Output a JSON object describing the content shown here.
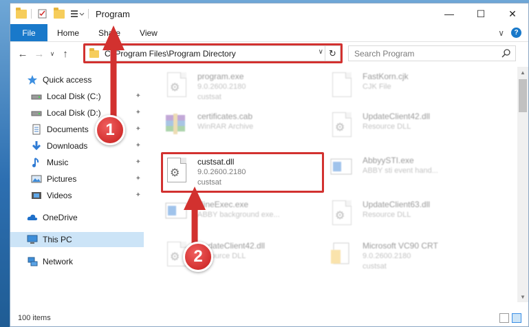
{
  "window": {
    "title": "Program",
    "controls": {
      "minimize": "—",
      "maximize": "☐",
      "close": "✕"
    }
  },
  "ribbon": {
    "file_label": "File",
    "tabs": [
      "Home",
      "Share",
      "View"
    ],
    "expand": "∨",
    "help": "?"
  },
  "nav": {
    "back": "←",
    "forward": "→",
    "recent": "∨",
    "up": "↑",
    "address": "C:\\Program Files\\Program Directory",
    "address_dropdown": "∨",
    "refresh": "↻",
    "search_placeholder": "Search Program"
  },
  "sidebar": {
    "items": [
      {
        "label": "Quick access",
        "icon": "star-icon",
        "pinned": false
      },
      {
        "label": "Local Disk (C:)",
        "icon": "drive-icon",
        "pinned": true
      },
      {
        "label": "Local Disk (D:)",
        "icon": "drive-icon",
        "pinned": true
      },
      {
        "label": "Documents",
        "icon": "documents-icon",
        "pinned": true
      },
      {
        "label": "Downloads",
        "icon": "download-icon",
        "pinned": true
      },
      {
        "label": "Music",
        "icon": "music-icon",
        "pinned": true
      },
      {
        "label": "Pictures",
        "icon": "pictures-icon",
        "pinned": true
      },
      {
        "label": "Videos",
        "icon": "videos-icon",
        "pinned": true
      },
      {
        "label": "OneDrive",
        "icon": "cloud-icon",
        "pinned": false
      },
      {
        "label": "This PC",
        "icon": "computer-icon",
        "pinned": false,
        "selected": true
      },
      {
        "label": "Network",
        "icon": "network-icon",
        "pinned": false
      }
    ],
    "pin_glyph": "📌"
  },
  "files": [
    {
      "name": "program.exe",
      "sub1": "9.0.2600.2180",
      "sub2": "custsat",
      "ghost": true
    },
    {
      "name": "FastKorn.cjk",
      "sub1": "CJK File",
      "sub2": "",
      "ghost": true
    },
    {
      "name": "certificates.cab",
      "sub1": "WinRAR Archive",
      "sub2": "",
      "ghost": true
    },
    {
      "name": "UpdateClient42.dll",
      "sub1": "Resource DLL",
      "sub2": "",
      "ghost": true
    },
    {
      "name": "custsat.dll",
      "sub1": "9.0.2600.2180",
      "sub2": "custsat",
      "ghost": false
    },
    {
      "name": "AbbyySTI.exe",
      "sub1": "ABBY sti event hand...",
      "sub2": "",
      "ghost": true
    },
    {
      "name": "NineExec.exe",
      "sub1": "ABBY background exe...",
      "sub2": "",
      "ghost": true
    },
    {
      "name": "UpdateClient63.dll",
      "sub1": "Resource DLL",
      "sub2": "",
      "ghost": true
    },
    {
      "name": "UpdateClient42.dll",
      "sub1": "Resource DLL",
      "sub2": "",
      "ghost": true
    },
    {
      "name": "Microsoft VC90 CRT",
      "sub1": "9.0.2600.2180",
      "sub2": "custsat",
      "ghost": true
    }
  ],
  "status": {
    "items": "100 items"
  },
  "annotations": {
    "step1": "1",
    "step2": "2"
  },
  "colors": {
    "accent": "#1979ca",
    "highlight": "#d2312f",
    "selected": "#cce4f7"
  }
}
